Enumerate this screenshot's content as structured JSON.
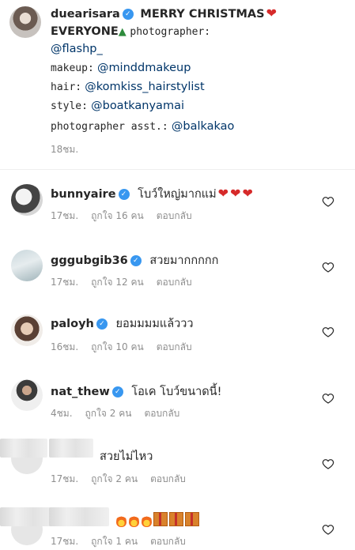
{
  "caption": {
    "username": "duearisara",
    "text": "MERRY CHRISTMAS",
    "text2": "EVERYONE",
    "label_photographer": "photographer:",
    "photographer": "@flashp_",
    "label_makeup": "makeup:",
    "makeup": "@minddmakeup",
    "label_hair": "hair:",
    "hair": "@komkiss_hairstylist",
    "label_style": "style:",
    "style": "@boatkanyamai",
    "label_asst": "photographer asst.:",
    "asst": "@balkakao",
    "time": "18ชม."
  },
  "comments": [
    {
      "username": "bunnyaire",
      "text": "โบว์ใหญ่มากแม่",
      "time": "17ชม.",
      "likes": "ถูกใจ 16 คน",
      "reply": "ตอบกลับ"
    },
    {
      "username": "gggubgib36",
      "text": "สวยมากกกกก",
      "time": "17ชม.",
      "likes": "ถูกใจ 12 คน",
      "reply": "ตอบกลับ"
    },
    {
      "username": "paloyh",
      "text": "ยอมมมมแล้ววว",
      "time": "16ชม.",
      "likes": "ถูกใจ 10 คน",
      "reply": "ตอบกลับ"
    },
    {
      "username": "nat_thew",
      "text": "โอเค โบว์ขนาดนี้!",
      "time": "4ชม.",
      "likes": "ถูกใจ 2 คน",
      "reply": "ตอบกลับ"
    },
    {
      "username": "",
      "text": "สวยไม่ไหว",
      "time": "17ชม.",
      "likes": "ถูกใจ 2 คน",
      "reply": "ตอบกลับ"
    },
    {
      "username": "",
      "text": "",
      "time": "17ชม.",
      "likes": "ถูกใจ 1 คน",
      "reply": "ตอบกลับ"
    }
  ],
  "colors": {
    "link": "#003569",
    "verified": "#3897f0",
    "meta": "#8e8e8e"
  },
  "icons": {
    "verified": "verified-badge-icon",
    "like": "heart-outline-icon"
  }
}
